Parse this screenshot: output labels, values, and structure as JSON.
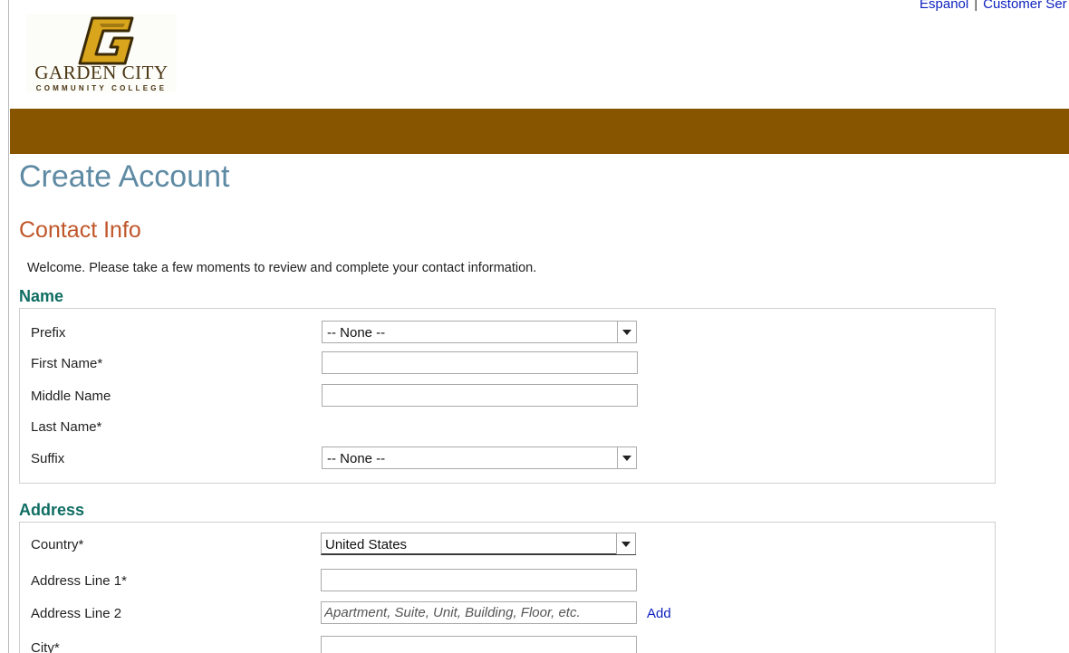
{
  "header": {
    "links": [
      {
        "label": "Espanol"
      },
      {
        "label": "Customer Ser"
      }
    ],
    "separator": "|",
    "logo": {
      "name": "GARDEN CITY",
      "subtitle": "COMMUNITY COLLEGE",
      "mark": "GC",
      "colors": {
        "brand": "#875500",
        "gold": "#d8a51c"
      }
    },
    "banner_color": "#875500"
  },
  "page": {
    "title": "Create Account",
    "section_title": "Contact Info",
    "welcome": "Welcome. Please take a few moments to review and complete your contact information."
  },
  "name_section": {
    "title": "Name",
    "prefix": {
      "label": "Prefix",
      "value": "-- None --"
    },
    "first_name": {
      "label": "First Name*",
      "value": ""
    },
    "middle_name": {
      "label": "Middle Name",
      "value": ""
    },
    "last_name": {
      "label": "Last Name*"
    },
    "suffix": {
      "label": "Suffix",
      "value": "-- None --"
    }
  },
  "address_section": {
    "title": "Address",
    "country": {
      "label": "Country*",
      "value": "United States"
    },
    "address_line_1": {
      "label": "Address Line 1*",
      "value": ""
    },
    "address_line_2": {
      "label": "Address Line 2",
      "placeholder": "Apartment, Suite, Unit, Building, Floor, etc.",
      "add_label": "Add"
    },
    "city": {
      "label": "City*",
      "value": ""
    }
  }
}
